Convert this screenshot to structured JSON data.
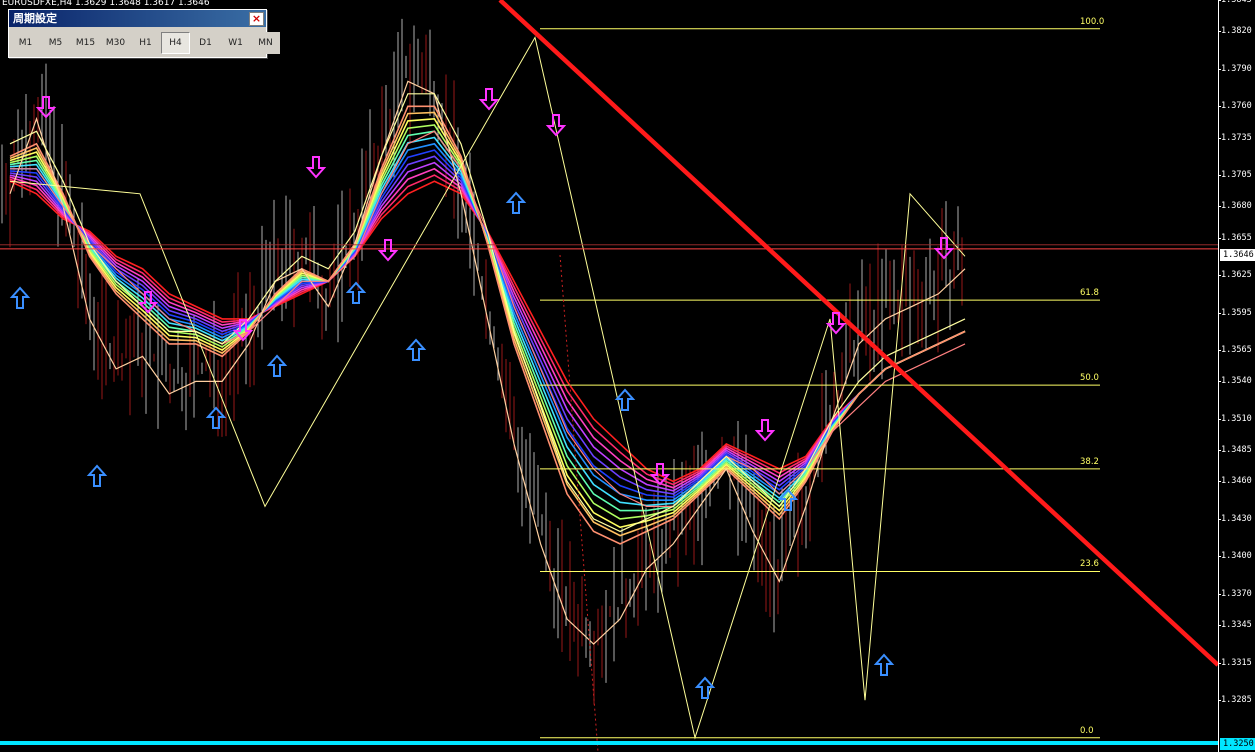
{
  "symbol_info": "EURUSDFXE,H4  1.3629 1.3648 1.3617 1.3646",
  "panel": {
    "title": "周期設定",
    "close_label": "×",
    "timeframes": [
      {
        "label": "M1",
        "active": false
      },
      {
        "label": "M5",
        "active": false
      },
      {
        "label": "M15",
        "active": false
      },
      {
        "label": "M30",
        "active": false
      },
      {
        "label": "H1",
        "active": false
      },
      {
        "label": "H4",
        "active": true
      },
      {
        "label": "D1",
        "active": false
      },
      {
        "label": "W1",
        "active": false
      },
      {
        "label": "MN",
        "active": false
      }
    ]
  },
  "current_price_label": "1.3646",
  "low_price_label": "1.3250",
  "colors": {
    "background": "#000000",
    "trendline": "#ff1a1a",
    "fib": "#ffff66",
    "up_arrow": "#3a8fff",
    "down_arrow": "#ff33ff",
    "price_line": "#ff4444",
    "cyan_line": "#00e5ff"
  },
  "chart_data": {
    "type": "line",
    "instrument": "EURUSDFXE",
    "timeframe": "H4",
    "ylim": [
      1.325,
      1.3845
    ],
    "y_ticks": [
      "1.3845",
      "1.3820",
      "1.3790",
      "1.3760",
      "1.3735",
      "1.3705",
      "1.3680",
      "1.3655",
      "1.3625",
      "1.3595",
      "1.3565",
      "1.3540",
      "1.3510",
      "1.3485",
      "1.3460",
      "1.3430",
      "1.3400",
      "1.3370",
      "1.3345",
      "1.3315",
      "1.3285"
    ],
    "y_tick_values": [
      1.3845,
      1.382,
      1.379,
      1.376,
      1.3735,
      1.3705,
      1.368,
      1.3655,
      1.3625,
      1.3595,
      1.3565,
      1.354,
      1.351,
      1.3485,
      1.346,
      1.343,
      1.34,
      1.337,
      1.3345,
      1.3315,
      1.3285
    ],
    "current_price": 1.3646,
    "fib_levels": [
      {
        "label": "100.0",
        "value": 1.3822
      },
      {
        "label": "61.8",
        "value": 1.3605
      },
      {
        "label": "50.0",
        "value": 1.3537
      },
      {
        "label": "38.2",
        "value": 1.347
      },
      {
        "label": "23.6",
        "value": 1.3388
      },
      {
        "label": "0.0",
        "value": 1.3255
      }
    ],
    "series": [
      {
        "values": [
          1.37,
          1.369,
          1.367,
          1.366,
          1.364,
          1.363,
          1.361,
          1.36,
          1.359,
          1.359,
          1.36,
          1.361,
          1.362,
          1.364,
          1.367,
          1.369,
          1.37,
          1.369,
          1.366,
          1.362,
          1.358,
          1.354,
          1.351,
          1.349,
          1.347,
          1.346,
          1.347,
          1.349,
          1.348,
          1.347,
          1.348,
          1.351,
          1.353,
          1.355,
          1.356,
          1.357,
          1.358
        ]
      },
      {
        "values": [
          1.371,
          1.371,
          1.368,
          1.365,
          1.363,
          1.361,
          1.359,
          1.358,
          1.357,
          1.358,
          1.36,
          1.362,
          1.362,
          1.364,
          1.369,
          1.373,
          1.374,
          1.371,
          1.366,
          1.36,
          1.355,
          1.35,
          1.347,
          1.345,
          1.344,
          1.344,
          1.346,
          1.348,
          1.347,
          1.345,
          1.347,
          1.35,
          1.352,
          1.354,
          1.355,
          1.356,
          1.357
        ]
      },
      {
        "values": [
          1.372,
          1.373,
          1.369,
          1.364,
          1.361,
          1.359,
          1.357,
          1.357,
          1.356,
          1.358,
          1.361,
          1.363,
          1.362,
          1.365,
          1.371,
          1.376,
          1.376,
          1.372,
          1.365,
          1.357,
          1.351,
          1.345,
          1.342,
          1.341,
          1.342,
          1.343,
          1.345,
          1.347,
          1.345,
          1.343,
          1.346,
          1.35,
          1.353,
          1.355,
          1.356,
          1.357,
          1.358
        ]
      },
      {
        "values": [
          1.37,
          1.376,
          1.369,
          1.36,
          1.356,
          1.357,
          1.354,
          1.355,
          1.355,
          1.358,
          1.363,
          1.364,
          1.361,
          1.366,
          1.373,
          1.379,
          1.378,
          1.37,
          1.36,
          1.35,
          1.342,
          1.336,
          1.334,
          1.336,
          1.34,
          1.342,
          1.345,
          1.348,
          1.343,
          1.339,
          1.345,
          1.352,
          1.358,
          1.36,
          1.361,
          1.362,
          1.364
        ]
      }
    ],
    "signals_up_count": 13,
    "signals_down_count": 11
  }
}
